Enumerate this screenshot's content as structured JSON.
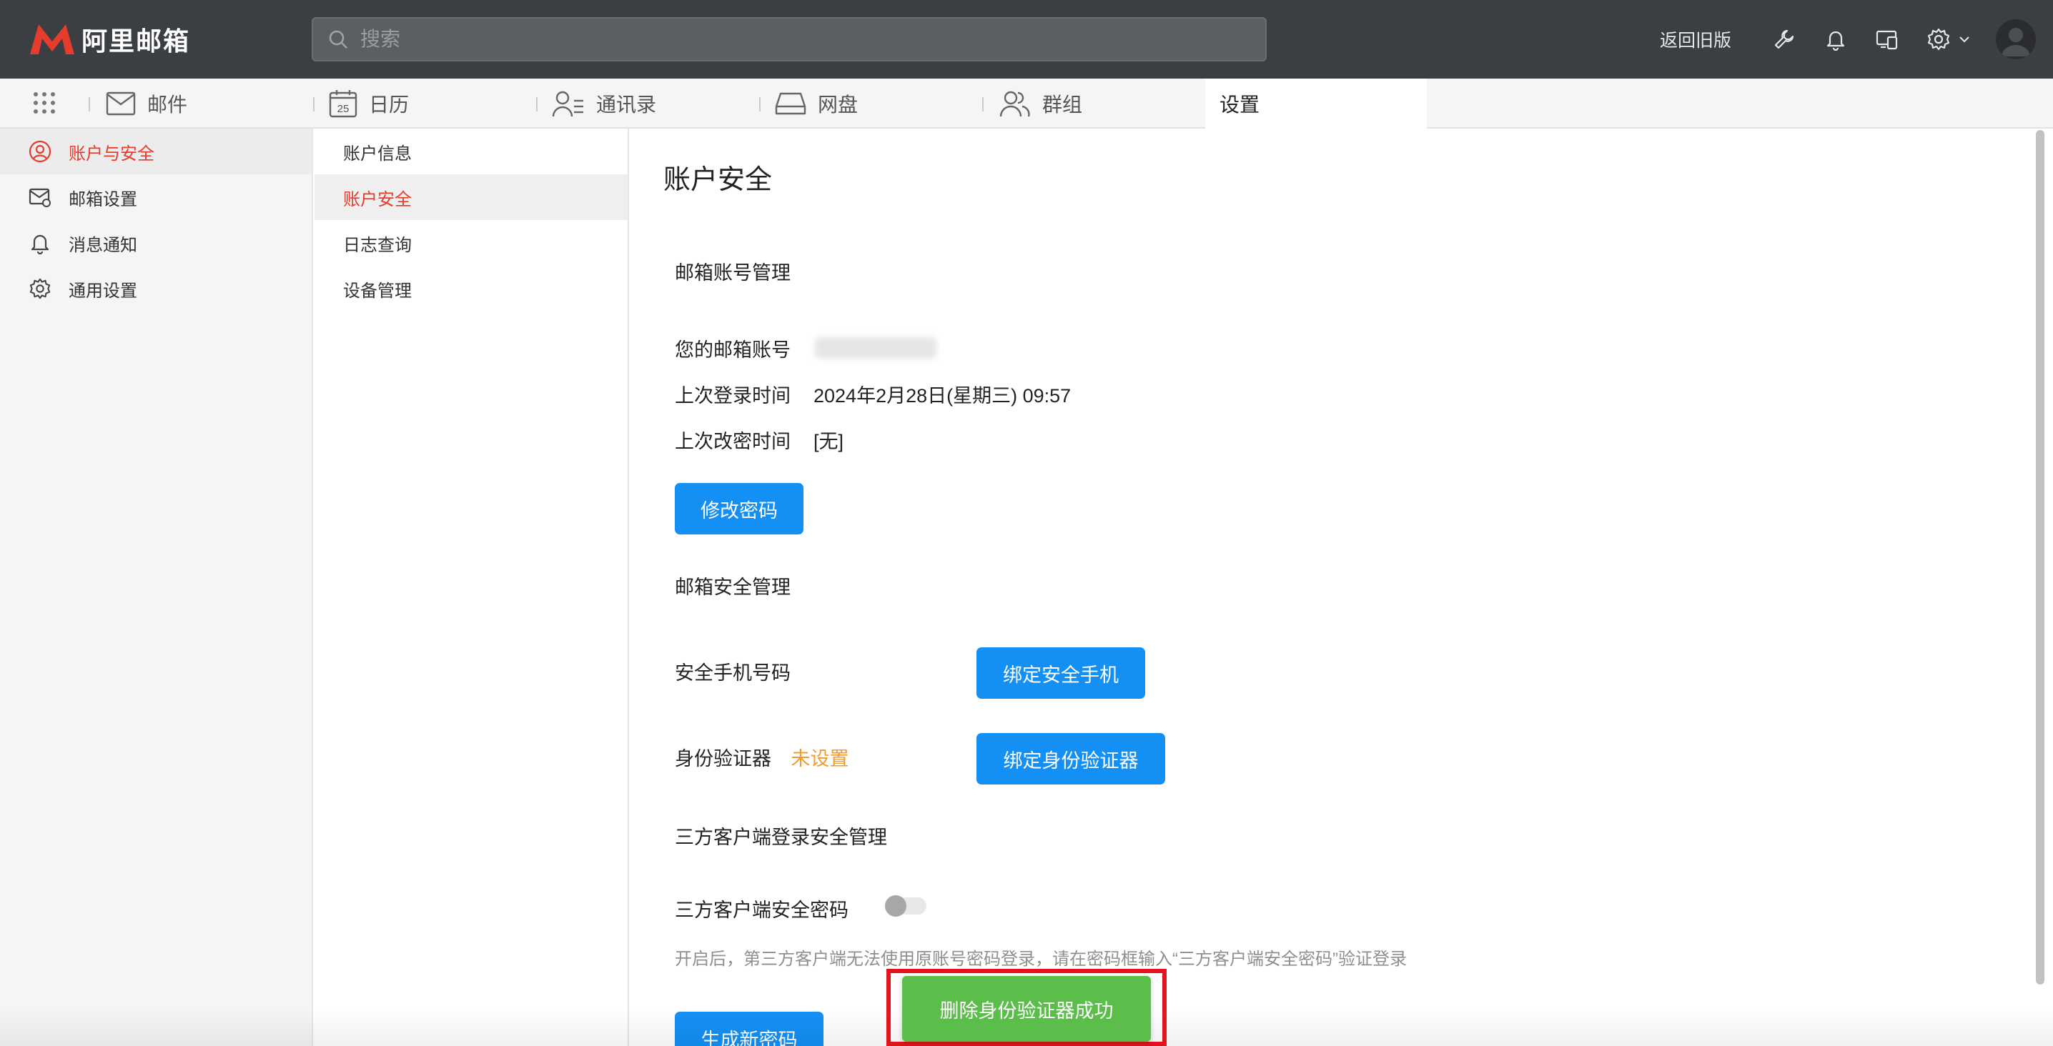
{
  "brand": {
    "name": "阿里邮箱",
    "logo_color": "#e63c2e"
  },
  "search": {
    "placeholder": "搜索"
  },
  "topbar": {
    "old_version": "返回旧版"
  },
  "nav": {
    "tabs": [
      {
        "label": "邮件",
        "icon": "mail-icon"
      },
      {
        "label": "日历",
        "icon": "calendar-icon",
        "calendar_day": "25"
      },
      {
        "label": "通讯录",
        "icon": "contacts-icon"
      },
      {
        "label": "网盘",
        "icon": "drive-icon"
      },
      {
        "label": "群组",
        "icon": "group-icon"
      },
      {
        "label": "设置",
        "icon": "",
        "active": true
      }
    ]
  },
  "sidebar": {
    "items": [
      {
        "label": "账户与安全",
        "icon": "user-circle-icon",
        "active": true
      },
      {
        "label": "邮箱设置",
        "icon": "mail-settings-icon"
      },
      {
        "label": "消息通知",
        "icon": "bell-icon"
      },
      {
        "label": "通用设置",
        "icon": "gear-icon"
      }
    ]
  },
  "submenu": {
    "items": [
      {
        "label": "账户信息"
      },
      {
        "label": "账户安全",
        "active": true
      },
      {
        "label": "日志查询"
      },
      {
        "label": "设备管理"
      }
    ]
  },
  "main": {
    "title": "账户安全",
    "account_section": {
      "title": "邮箱账号管理",
      "account_label": "您的邮箱账号",
      "last_login_label": "上次登录时间",
      "last_login_value": "2024年2月28日(星期三) 09:57",
      "last_pw_change_label": "上次改密时间",
      "last_pw_change_value": "[无]",
      "change_password_button": "修改密码"
    },
    "security_section": {
      "title": "邮箱安全管理",
      "phone_label": "安全手机号码",
      "bind_phone_button": "绑定安全手机",
      "authenticator_label": "身份验证器",
      "authenticator_status": "未设置",
      "bind_authenticator_button": "绑定身份验证器"
    },
    "third_party_section": {
      "title": "三方客户端登录安全管理",
      "password_label": "三方客户端安全密码",
      "toggle_on": false,
      "hint": "开启后，第三方客户端无法使用原账号密码登录，请在密码框输入“三方客户端安全密码”验证登录",
      "generate_button": "生成新密码"
    }
  },
  "toast": {
    "message": "删除身份验证器成功"
  },
  "colors": {
    "accent_blue": "#1490f5",
    "accent_red": "#e63c2e",
    "success_green": "#5bbd4a",
    "warning_orange": "#f29b2f",
    "topbar": "#3b3e43"
  }
}
